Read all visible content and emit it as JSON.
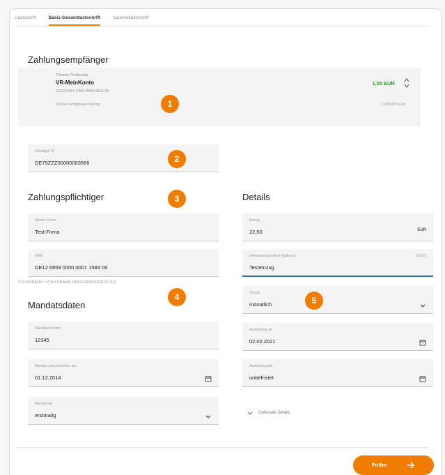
{
  "tabs": [
    {
      "label": "Lastschrift",
      "active": false
    },
    {
      "label": "Basis-Gesamtlastschrift",
      "active": true
    },
    {
      "label": "Sammellastschrift",
      "active": false
    }
  ],
  "payee": {
    "heading": "Zahlungsempfänger",
    "owner": "Thomas Testkunde",
    "account_name": "VR-MeinKonto",
    "iban": "DE22 6655 9300 8888 6833 00",
    "balance": "1,00 EUR",
    "available_label": "Online verfügbarer Betrag",
    "available_amount": "2.000,00 EUR"
  },
  "creditor_id": {
    "label": "Gläubiger-ID",
    "value": "DE75ZZZ00000003566"
  },
  "debtor": {
    "heading": "Zahlungspflichtiger",
    "name_label": "Name • Firma",
    "name_value": "Test-Firma",
    "iban_label": "IBAN",
    "iban_value": "DE12 6859 0000 0001 1583 06",
    "bank_name": "VOLKSBANK / VOLKSBANK DREILAENDERECK EG"
  },
  "mandate": {
    "heading": "Mandatsdaten",
    "reference_label": "Mandatsreferenz",
    "reference_value": "12345",
    "signed_label": "Mandat unterschrieben am",
    "signed_value": "01.12.2014",
    "type_label": "Mandatsart",
    "type_value": "erstmalig"
  },
  "details": {
    "heading": "Details",
    "amount_label": "Betrag",
    "amount_value": "22,50",
    "currency": "EUR",
    "purpose_label": "Verwendungszweck (optional)",
    "purpose_counter": "10/140",
    "purpose_value": "Testeinzug",
    "turnus_label": "Turnus",
    "turnus_value": "monatlich",
    "exec_from_label": "Ausführung ab",
    "exec_from_value": "02.02.2021",
    "exec_to_label": "Ausführung bis",
    "exec_to_value": "unbefristet",
    "optional_details": "Optionale Details"
  },
  "markers": [
    "1",
    "2",
    "3",
    "4",
    "5"
  ],
  "submit": {
    "label": "Prüfen"
  },
  "colors": {
    "accent": "#f07d00",
    "positive": "#2e9e2e",
    "focus": "#2e6da4"
  }
}
